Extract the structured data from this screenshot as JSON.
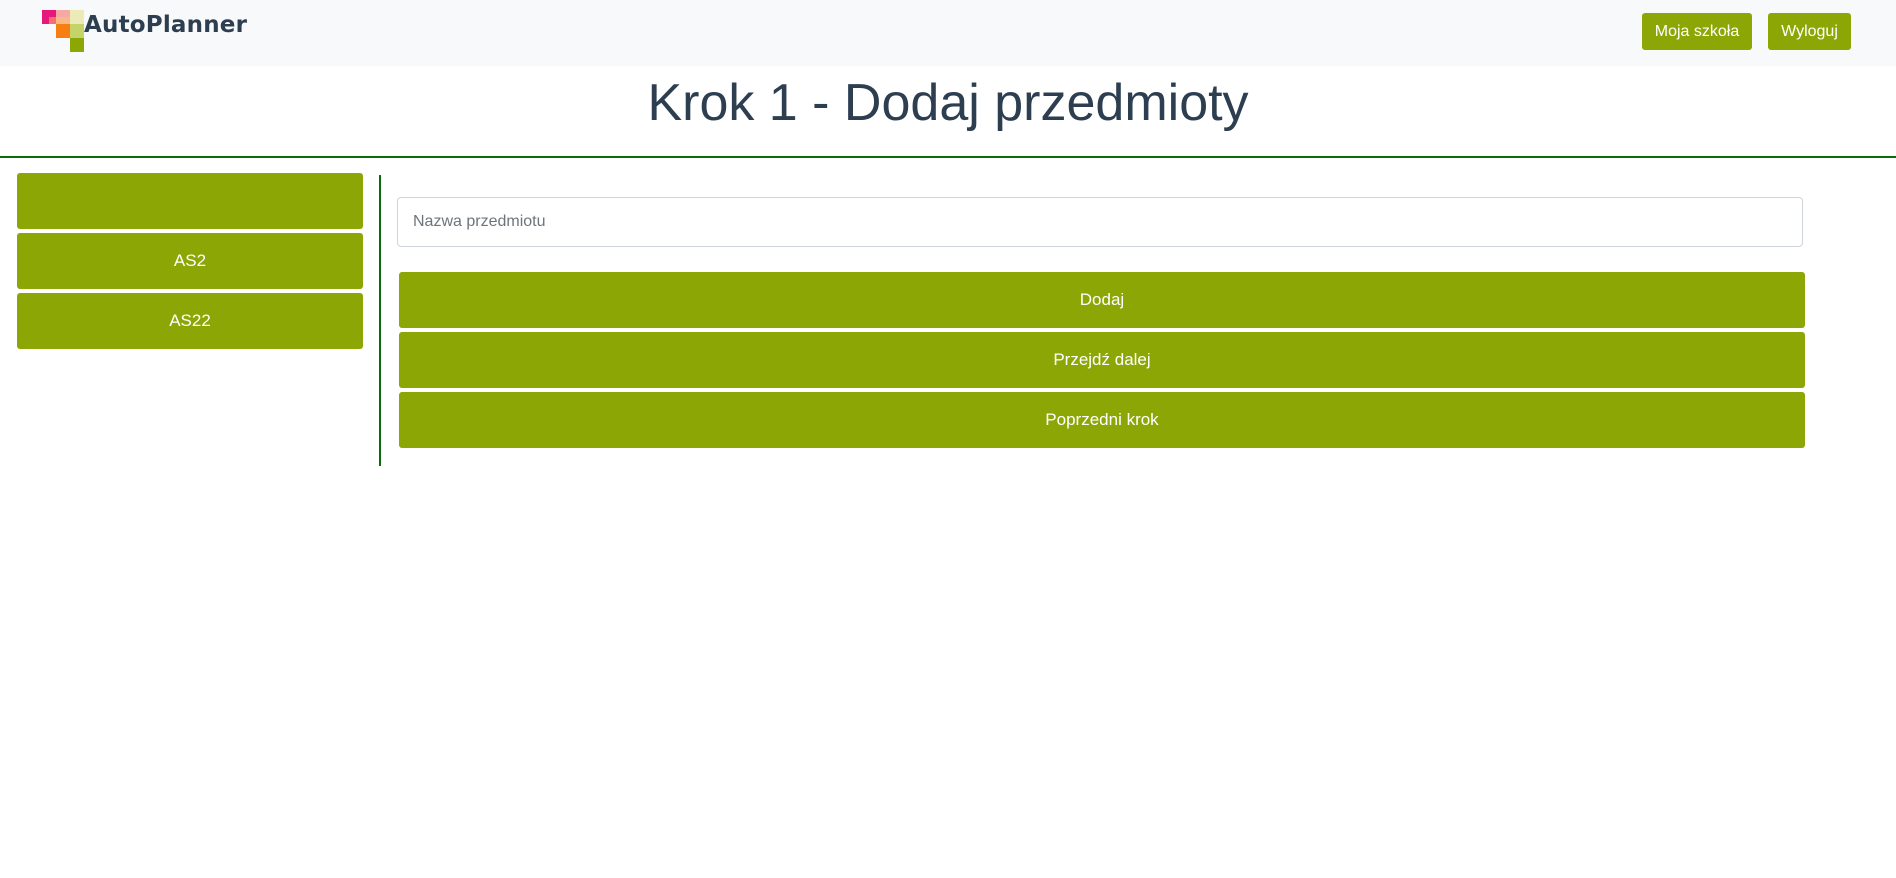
{
  "navbar": {
    "brand": "AutoPlanner",
    "logo_icon": "autoplanner-logo-icon",
    "buttons": {
      "school": "Moja szkoła",
      "logout": "Wyloguj"
    }
  },
  "page": {
    "title": "Krok 1 - Dodaj przedmioty"
  },
  "subjects": [
    {
      "label": ""
    },
    {
      "label": "AS2"
    },
    {
      "label": "AS22"
    }
  ],
  "form": {
    "subject_name": {
      "value": "",
      "placeholder": "Nazwa przedmiotu"
    },
    "buttons": {
      "add": "Dodaj",
      "next": "Przejdź dalej",
      "previous": "Poprzedni krok"
    }
  },
  "colors": {
    "accent": "#8ca705",
    "title_text": "#2c3e50",
    "divider": "#0b6b0b",
    "navbar_bg": "#f8f9fa"
  }
}
